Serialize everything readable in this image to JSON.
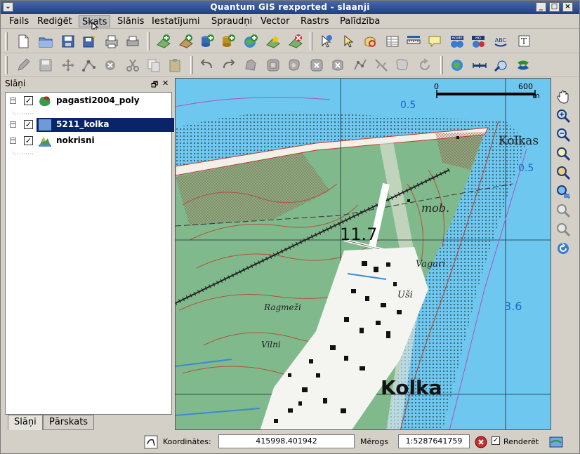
{
  "window": {
    "title": "Quantum GIS rexported - slaanji"
  },
  "menu": [
    "Fails",
    "Rediģēt",
    "Skats",
    "Slānis",
    "Iestatījumi",
    "Spraudņi",
    "Vector",
    "Rastrs",
    "Palīdzība"
  ],
  "layers_panel": {
    "title": "Slāņi",
    "layers": [
      {
        "name": "pagasti2004_poly",
        "checked": true,
        "selected": false
      },
      {
        "name": "5211_kolka",
        "checked": true,
        "selected": true
      },
      {
        "name": "nokrisni",
        "checked": true,
        "selected": false
      }
    ],
    "tabs": [
      "Slāņi",
      "Pārskats"
    ]
  },
  "map": {
    "scalebar": {
      "start": "0",
      "end": "600",
      "unit": "m"
    },
    "labels": {
      "depth1": "0.5",
      "depth2": "0.5",
      "depth3": "3.6",
      "kolkas": "Kolkas",
      "mob": "mob.",
      "elev": "11.7",
      "vagari": "Vagari",
      "usi": "Uši",
      "ragmezi": "Ragmeži",
      "vilni": "Vilni",
      "kolka": "Kolka"
    },
    "colors": {
      "sea": "#6ec7ee",
      "land": "#80b98c",
      "contour": "#b0543c"
    }
  },
  "statusbar": {
    "coords_label": "Koordinātes:",
    "coords_value": "415998,401942",
    "scale_label": "Mērogs",
    "scale_value": "1:5287641759",
    "render_label": "Renderēt",
    "render_checked": true
  }
}
